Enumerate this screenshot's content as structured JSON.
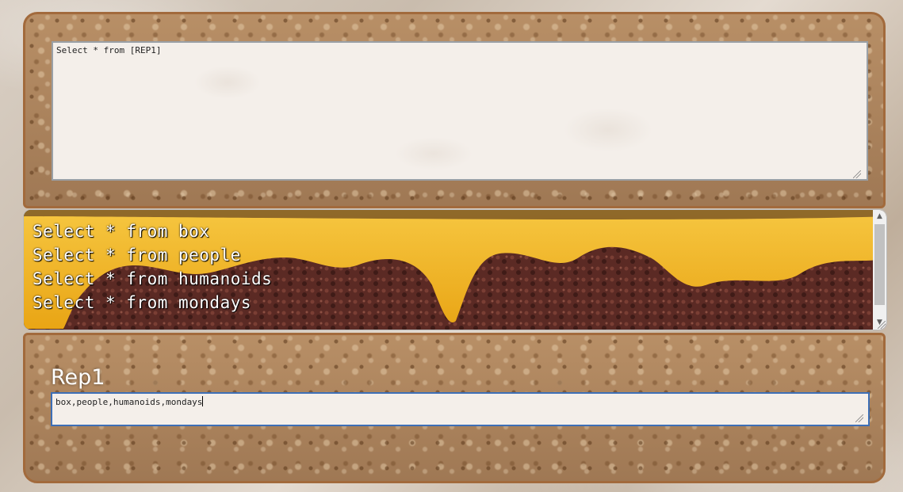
{
  "query_box": {
    "value": "Select * from [REP1]"
  },
  "results": {
    "lines": [
      "Select * from box",
      "Select * from people",
      "Select * from humanoids",
      "Select * from mondays"
    ]
  },
  "replacement": {
    "label": "Rep1",
    "value": "box,people,humanoids,mondays"
  },
  "icons": {
    "scroll_up": "scroll-up-arrow",
    "scroll_down": "scroll-down-arrow",
    "resize": "resize-grip"
  },
  "colors": {
    "bread_crust": "#a26a3c",
    "cheese": "#f2b322",
    "patty": "#5a2a22",
    "focus_border": "#3d6fb6"
  }
}
